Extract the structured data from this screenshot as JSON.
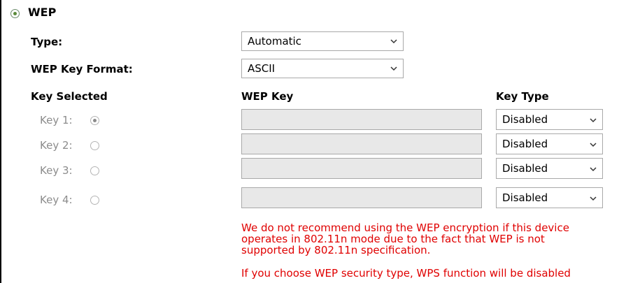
{
  "wep": {
    "title": "WEP",
    "selected": true
  },
  "type": {
    "label": "Type:",
    "value": "Automatic"
  },
  "key_format": {
    "label": "WEP Key Format:",
    "value": "ASCII"
  },
  "columns": {
    "key_selected": "Key Selected",
    "wep_key": "WEP Key",
    "key_type": "Key Type"
  },
  "keys": [
    {
      "label": "Key 1:",
      "selected": true,
      "value": "",
      "type": "Disabled"
    },
    {
      "label": "Key 2:",
      "selected": false,
      "value": "",
      "type": "Disabled"
    },
    {
      "label": "Key 3:",
      "selected": false,
      "value": "",
      "type": "Disabled"
    },
    {
      "label": "Key 4:",
      "selected": false,
      "value": "",
      "type": "Disabled"
    }
  ],
  "warnings": {
    "line1": "We do not recommend using the WEP encryption if this device",
    "line2": "operates in 802.11n mode due to the fact that WEP is not",
    "line3": "supported by 802.11n specification.",
    "line4": "If you choose WEP security type, WPS function will be disabled"
  },
  "colors": {
    "warning": "#e00000",
    "disabled_label": "#8c8c8c"
  }
}
